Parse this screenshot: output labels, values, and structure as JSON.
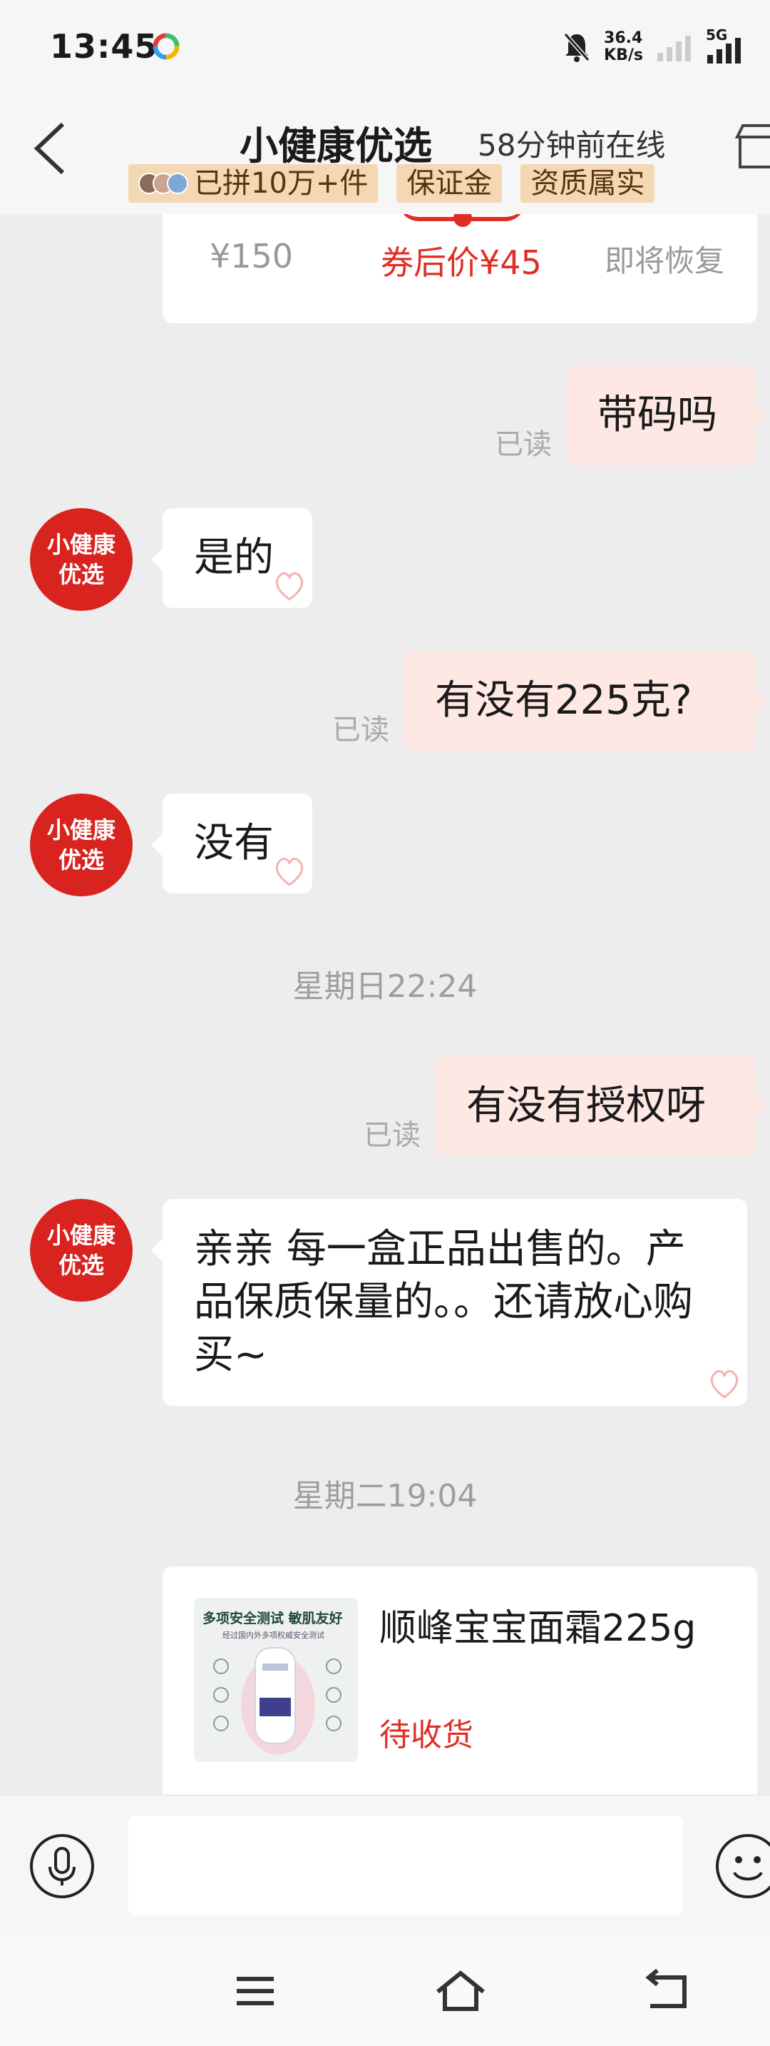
{
  "status_bar": {
    "time": "13:45",
    "net_speed": "36.4",
    "net_unit": "KB/s",
    "network_type": "5G"
  },
  "header": {
    "shop_name": "小健康优选",
    "online_status": "58分钟前在线",
    "badges": [
      "已拼10万+件",
      "保证金",
      "资质属实"
    ]
  },
  "product_card": {
    "original_price": "¥150",
    "coupon_price": "券后价¥45",
    "restore_text": "即将恢复"
  },
  "messages": [
    {
      "from": "me",
      "text": "带码吗",
      "read": "已读"
    },
    {
      "from": "them",
      "text": "是的",
      "avatar_line1": "小健康",
      "avatar_line2": "优选"
    },
    {
      "from": "me",
      "text": "有没有225克?",
      "read": "已读"
    },
    {
      "from": "them",
      "text": "没有",
      "avatar_line1": "小健康",
      "avatar_line2": "优选"
    },
    {
      "from": "me",
      "text": "有没有授权呀",
      "read": "已读"
    },
    {
      "from": "them",
      "text": "亲亲 每一盒正品出售的。产品保质保量的。。还请放心购买~",
      "avatar_line1": "小健康",
      "avatar_line2": "优选"
    }
  ],
  "timestamps": [
    "星期日22:24",
    "星期二19:04"
  ],
  "order_card": {
    "thumb_title": "多项安全测试 敏肌友好",
    "thumb_subtitle": "经过国内外多项权威安全测试",
    "product_name": "顺峰宝宝面霜225g",
    "status": "待收货"
  },
  "input": {
    "placeholder": ""
  },
  "colors": {
    "accent_red": "#e02e24",
    "my_bubble": "#fde8e4",
    "badge_bg": "#f4d8b4"
  },
  "icons": [
    "app-logo-icon",
    "mute-bell-icon",
    "signal-icon",
    "back-arrow-icon",
    "store-icon",
    "voice-icon",
    "emoji-icon",
    "menu-icon",
    "home-icon",
    "return-icon",
    "pin-watermark-icon"
  ]
}
